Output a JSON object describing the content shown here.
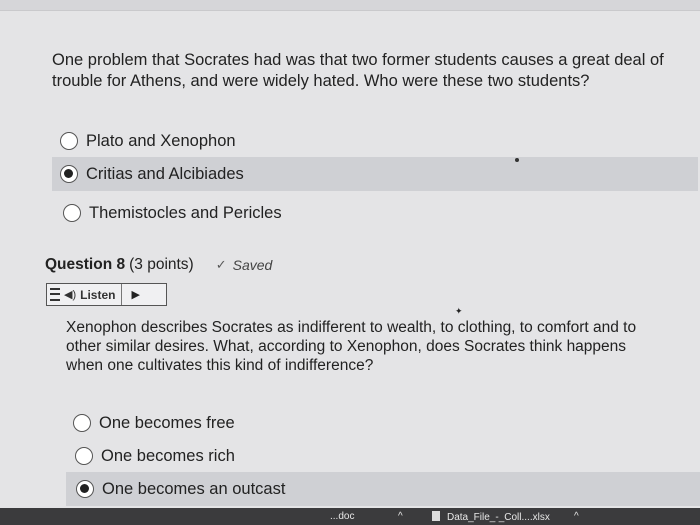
{
  "question7": {
    "text": "One problem that Socrates had was that two former students causes a great deal of trouble for Athens, and were widely hated. Who were these two students?",
    "options": [
      {
        "label": "Plato and Xenophon",
        "selected": false
      },
      {
        "label": "Critias and Alcibiades",
        "selected": true
      },
      {
        "label": "Themistocles and Pericles",
        "selected": false
      }
    ]
  },
  "question8": {
    "title": "Question 8",
    "points": "(3 points)",
    "saved_label": "Saved",
    "listen_label": "Listen",
    "text": "Xenophon describes Socrates as indifferent to wealth, to clothing, to comfort and to other similar desires. What, according to Xenophon, does Socrates think happens when one cultivates this kind of indifference?",
    "options": [
      {
        "label": "One becomes free",
        "selected": false
      },
      {
        "label": "One becomes rich",
        "selected": false
      },
      {
        "label": "One becomes an outcast",
        "selected": true
      }
    ]
  },
  "taskbar": {
    "download1": "...doc",
    "download2": "Data_File_-_Coll....xlsx"
  }
}
